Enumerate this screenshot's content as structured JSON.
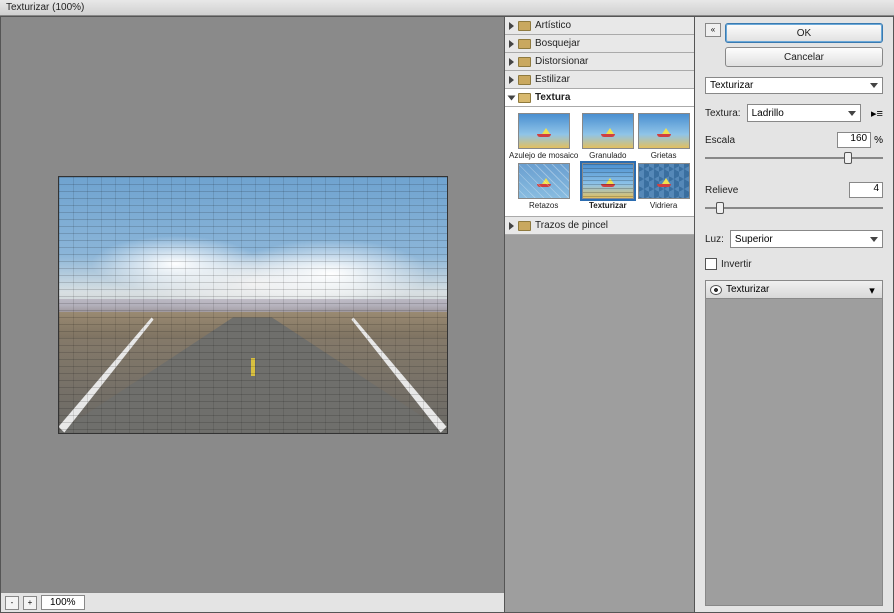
{
  "window": {
    "title": "Texturizar (100%)"
  },
  "preview": {
    "zoom": "100%"
  },
  "categories": [
    {
      "label": "Artístico",
      "expanded": false
    },
    {
      "label": "Bosquejar",
      "expanded": false
    },
    {
      "label": "Distorsionar",
      "expanded": false
    },
    {
      "label": "Estilizar",
      "expanded": false
    },
    {
      "label": "Textura",
      "expanded": true
    },
    {
      "label": "Trazos de pincel",
      "expanded": false
    }
  ],
  "thumbs": [
    {
      "label": "Azulejo de mosaico",
      "kind": "mosaic"
    },
    {
      "label": "Granulado",
      "kind": "grain"
    },
    {
      "label": "Grietas",
      "kind": "crack"
    },
    {
      "label": "Retazos",
      "kind": "patch"
    },
    {
      "label": "Texturizar",
      "kind": "brick",
      "selected": true
    },
    {
      "label": "Vidriera",
      "kind": "hex"
    }
  ],
  "buttons": {
    "ok": "OK",
    "cancel": "Cancelar"
  },
  "filter_dropdown": "Texturizar",
  "params": {
    "texture_label": "Textura:",
    "texture_value": "Ladrillo",
    "scale_label": "Escala",
    "scale_value": "160",
    "scale_suffix": "%",
    "relief_label": "Relieve",
    "relief_value": "4",
    "light_label": "Luz:",
    "light_value": "Superior",
    "invert_label": "Invertir"
  },
  "layers": {
    "active": "Texturizar"
  }
}
